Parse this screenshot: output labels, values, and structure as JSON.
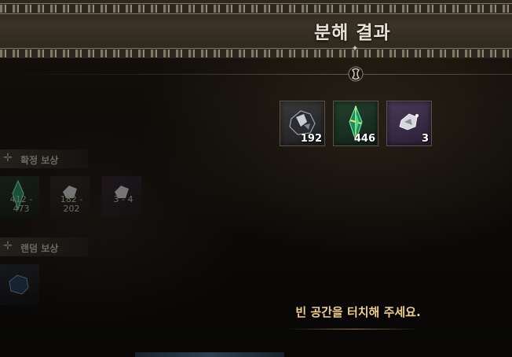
{
  "dialog": {
    "title": "분해 결과"
  },
  "results": [
    {
      "icon": "ore-icon",
      "count": "192",
      "bg": "#2e2e30"
    },
    {
      "icon": "green-crystal-icon",
      "count": "446",
      "bg": "#1c3324"
    },
    {
      "icon": "silver-shard-icon",
      "count": "3",
      "bg": "#3a2d48"
    }
  ],
  "side_panel": {
    "fixed_reward_label": "확정 보상",
    "fixed_items": [
      {
        "icon": "green-crystal-icon",
        "range": "412 - 473"
      },
      {
        "icon": "silver-shard-icon",
        "range": "182 - 202"
      },
      {
        "icon": "silver-shard-icon",
        "range": "3 - 4"
      }
    ],
    "random_reward_label": "랜덤 보상",
    "random_items": [
      {
        "icon": "ore-icon"
      }
    ]
  },
  "prompt": {
    "text": "빈 공간을 터치해 주세요."
  },
  "colors": {
    "prompt": "#efd089",
    "title": "#e9e3d6",
    "frame": "#5c5347"
  }
}
